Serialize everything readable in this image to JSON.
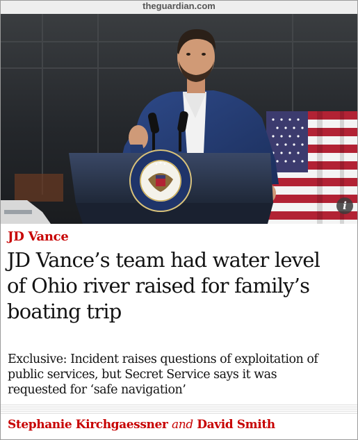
{
  "site": {
    "domain": "theguardian.com"
  },
  "photo": {
    "info_icon": "i",
    "seal_text": "VICE PRESIDENT OF THE UNITED STATES"
  },
  "article": {
    "kicker": "JD Vance",
    "headline_lines": [
      "JD Vance’s team had water level",
      "of Ohio river raised for family’s",
      "boating trip"
    ],
    "standfirst_lines": [
      "Exclusive: Incident raises questions of exploitation of",
      "public services, but Secret Service says it was",
      "requested for ‘safe navigation’"
    ],
    "byline": {
      "author_1": "Stephanie Kirchgaessner",
      "conjunction": "and",
      "author_2": "David Smith"
    }
  },
  "colors": {
    "accent": "#c70000",
    "text": "#121212"
  }
}
